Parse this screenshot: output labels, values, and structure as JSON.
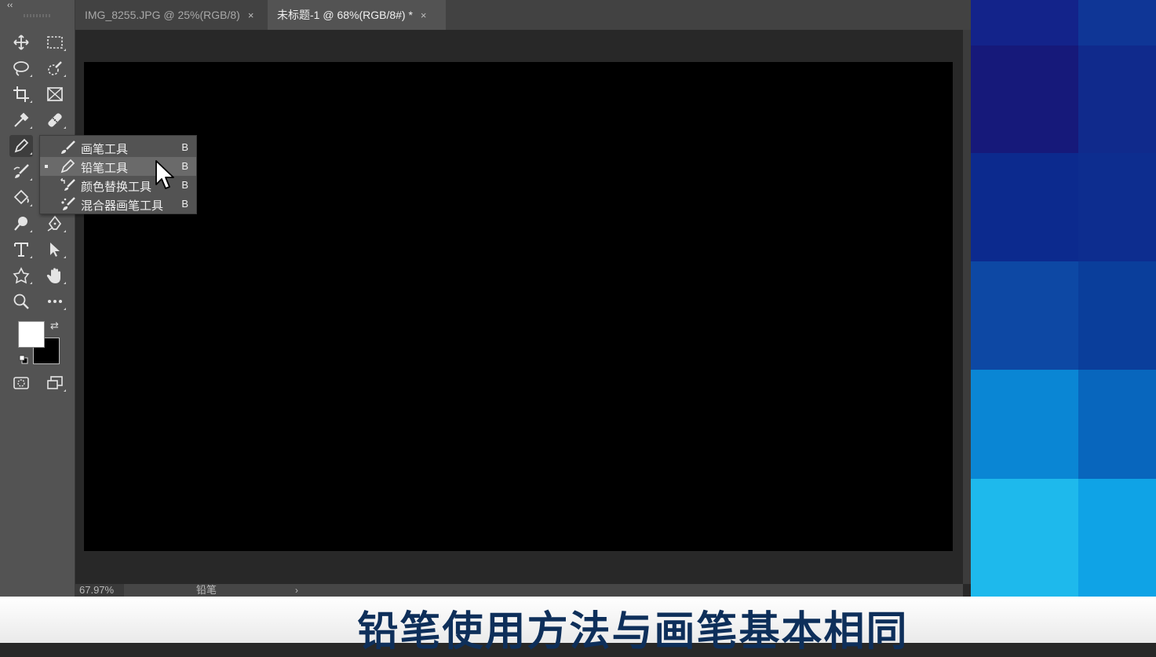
{
  "toolbar": {
    "collapse_glyph": "‹‹",
    "tools": [
      {
        "name": "move-tool",
        "icon": "move-icon"
      },
      {
        "name": "marquee-tool",
        "icon": "rect-marquee-icon"
      },
      {
        "name": "lasso-tool",
        "icon": "lasso-icon"
      },
      {
        "name": "quick-select-tool",
        "icon": "quick-select-icon"
      },
      {
        "name": "crop-tool",
        "icon": "crop-icon"
      },
      {
        "name": "frame-tool",
        "icon": "frame-icon"
      },
      {
        "name": "eyedropper-tool",
        "icon": "eyedropper-icon"
      },
      {
        "name": "healing-tool",
        "icon": "bandage-icon"
      },
      {
        "name": "pencil-tool",
        "icon": "pencil-icon",
        "active": true
      },
      {
        "name": "history-brush-tool",
        "icon": "history-brush-icon"
      },
      {
        "name": "paint-bucket-tool",
        "icon": "paint-bucket-icon"
      },
      {
        "name": "dodge-tool",
        "icon": "dodge-icon"
      },
      {
        "name": "pen-tool",
        "icon": "pen-icon"
      },
      {
        "name": "type-tool",
        "icon": "type-icon"
      },
      {
        "name": "path-select-tool",
        "icon": "arrow-icon"
      },
      {
        "name": "shape-tool",
        "icon": "custom-shape-icon"
      },
      {
        "name": "hand-tool",
        "icon": "hand-icon"
      },
      {
        "name": "zoom-tool",
        "icon": "zoom-icon"
      },
      {
        "name": "more-tools",
        "icon": "ellipsis-icon"
      },
      {
        "name": "quick-mask",
        "icon": "quick-mask-icon"
      },
      {
        "name": "screen-mode",
        "icon": "screen-mode-icon"
      }
    ],
    "foreground_color": "#ffffff",
    "background_color": "#000000",
    "swap_glyph": "⇄"
  },
  "tabs": [
    {
      "label": "IMG_8255.JPG @ 25%(RGB/8)",
      "close": "×",
      "active": false
    },
    {
      "label": "未标题-1 @ 68%(RGB/8#) *",
      "close": "×",
      "active": true
    }
  ],
  "flyout": {
    "items": [
      {
        "label": "画笔工具",
        "shortcut": "B",
        "icon": "brush-icon",
        "selected": false
      },
      {
        "label": "铅笔工具",
        "shortcut": "B",
        "icon": "pencil-icon",
        "selected": true
      },
      {
        "label": "颜色替换工具",
        "shortcut": "B",
        "icon": "color-replace-icon",
        "selected": false
      },
      {
        "label": "混合器画笔工具",
        "shortcut": "B",
        "icon": "mixer-brush-icon",
        "selected": false
      }
    ]
  },
  "status": {
    "zoom": "67.97%",
    "doc_info": "铅笔",
    "arrow": "›"
  },
  "caption": "铅笔使用方法与画笔基本相同",
  "colors": {
    "canvas": "#000000",
    "toolbar": "#535353",
    "caption_text": "#0e2f5a"
  }
}
